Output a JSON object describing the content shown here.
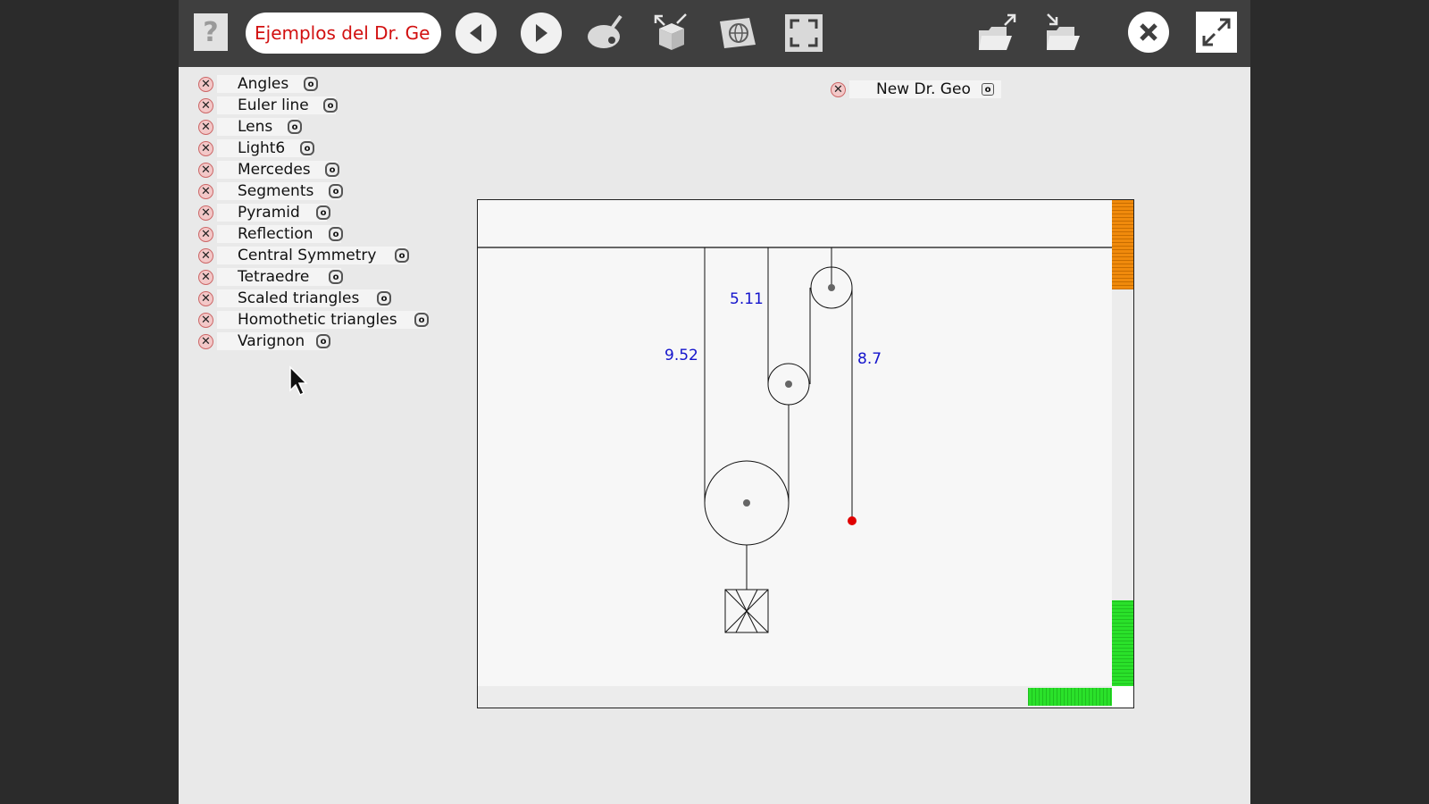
{
  "toolbar": {
    "help_label": "?",
    "title_value": "Ejemplos del Dr. Ge"
  },
  "sketches": [
    {
      "label": "Angles"
    },
    {
      "label": "Euler line"
    },
    {
      "label": "Lens"
    },
    {
      "label": "Light6"
    },
    {
      "label": "Mercedes"
    },
    {
      "label": "Segments"
    },
    {
      "label": "Pyramid"
    },
    {
      "label": "Reflection"
    },
    {
      "label": "Central Symmetry"
    },
    {
      "label": "Tetraedre"
    },
    {
      "label": "Scaled triangles"
    },
    {
      "label": "Homothetic triangles"
    },
    {
      "label": "Varignon"
    }
  ],
  "new_drgeo": {
    "label": "New Dr. Geo"
  },
  "canvas": {
    "length_a": "5.11",
    "length_b": "9.52",
    "length_c": "8.7"
  },
  "colors": {
    "title_text": "#d21010",
    "measure_text": "#1414cc",
    "scroll_orange": "#f08a0c",
    "scroll_green": "#2ae12a",
    "free_point": "#e00000"
  },
  "icons": [
    "help-icon",
    "arrow-left-icon",
    "arrow-right-icon",
    "paint-icon",
    "box-icon",
    "web-icon",
    "frame-icon",
    "open-export-icon",
    "open-import-icon",
    "close-icon",
    "expand-icon"
  ]
}
